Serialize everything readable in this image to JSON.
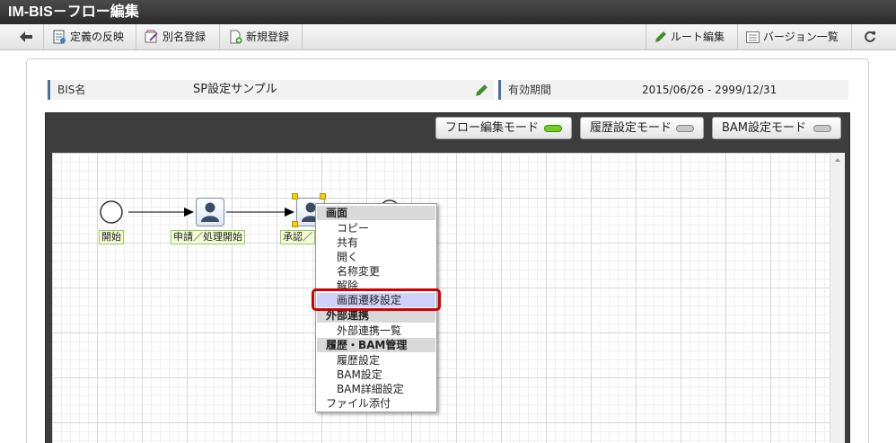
{
  "window": {
    "title": "IM-BIS－フロー編集"
  },
  "toolbar": {
    "back_icon": "back-arrow-icon",
    "apply_label": "定義の反映",
    "alias_label": "別名登録",
    "new_label": "新規登録",
    "route_edit_label": "ルート編集",
    "version_list_label": "バージョン一覧",
    "refresh_icon": "refresh-icon"
  },
  "info": {
    "bis_name_label": "BIS名",
    "bis_name_value": "SP設定サンプル",
    "period_label": "有効期間",
    "period_value": "2015/06/26 ‐ 2999/12/31"
  },
  "modes": {
    "flow_edit": "フロー編集モード",
    "history": "履歴設定モード",
    "bam": "BAM設定モード"
  },
  "nodes": {
    "start": "開始",
    "apply": "申請／処理開始",
    "approve": "承認／"
  },
  "context_menu": {
    "screen_header": "画面",
    "copy": "コピー",
    "share": "共有",
    "open": "開く",
    "rename": "名称変更",
    "release": "解除",
    "transition": "画面遷移設定",
    "external_header": "外部連携",
    "external_list": "外部連携一覧",
    "history_header": "履歴・BAM管理",
    "history_setting": "履歴設定",
    "bam_setting": "BAM設定",
    "bam_detail": "BAM詳細設定",
    "attach": "ファイル添付"
  },
  "colors": {
    "titlebar": "#333333",
    "active_mode": "#6fd021",
    "highlight": "#cfd3f7",
    "callout": "#d00000"
  }
}
